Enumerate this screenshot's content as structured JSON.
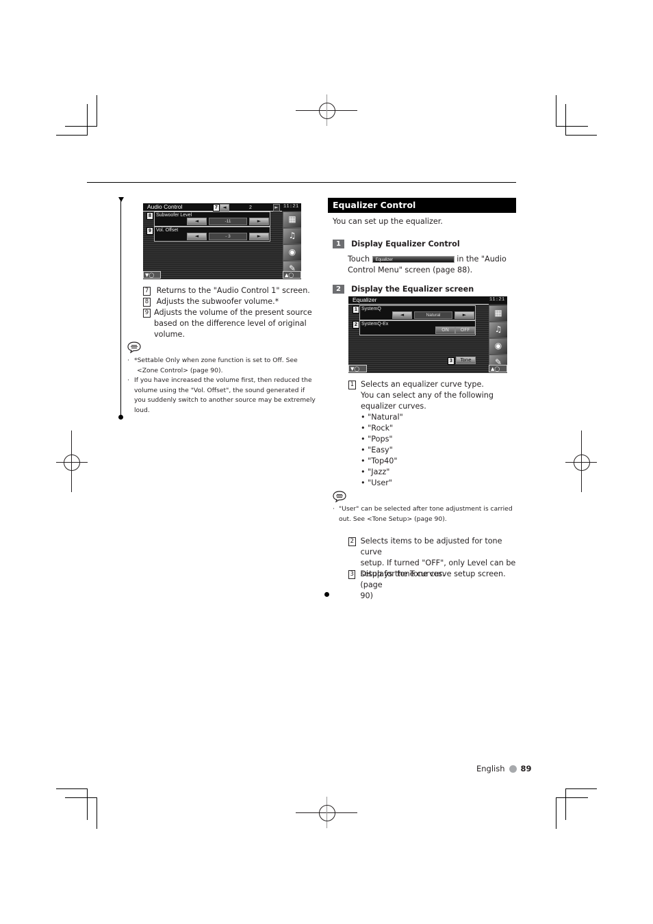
{
  "left_column": {
    "audio_control_screen": {
      "title": "Audio Control",
      "page_badge": "7",
      "page_number": "2",
      "clock": "11:21",
      "rows": [
        {
          "badge": "8",
          "label": "Subwoofer Level",
          "value": "-11"
        },
        {
          "badge": "9",
          "label": "Vol. Offset",
          "value": "- 3"
        }
      ]
    },
    "items": [
      {
        "num": "7",
        "text": "Returns to the \"Audio Control 1\" screen."
      },
      {
        "num": "8",
        "text": "Adjusts the subwoofer volume.*"
      },
      {
        "num": "9",
        "text_lines": [
          "Adjusts the volume of the present source",
          "based on the difference level of original",
          "volume."
        ]
      }
    ],
    "notes": [
      {
        "lines": [
          "*Settable Only when zone function is set to Off. See",
          "<Zone Control> (page 90)."
        ]
      },
      {
        "lines": [
          "If you have increased the volume first, then reduced the",
          "volume using the \"Vol. Offset\", the sound generated if",
          "you suddenly switch to another source may be extremely",
          "loud."
        ]
      }
    ]
  },
  "right_column": {
    "section_title": "Equalizer Control",
    "intro": "You can set up the equalizer.",
    "step1": {
      "num": "1",
      "title": "Display Equalizer Control",
      "touch_prefix": "Touch",
      "button_label": "Equalizer",
      "touch_suffix": "in the \"Audio",
      "line2": "Control Menu\" screen (page 88)."
    },
    "step2": {
      "num": "2",
      "title": "Display the Equalizer screen"
    },
    "equalizer_screen": {
      "title": "Equalizer",
      "clock": "11:21",
      "row1": {
        "badge": "1",
        "label": "SystemQ",
        "value": "Natural"
      },
      "row2": {
        "badge": "2",
        "label": "SystemQ-Ex",
        "on_label": "ON",
        "off_label": "OFF"
      },
      "tone": {
        "badge": "3",
        "label": "Tone"
      }
    },
    "item1": {
      "num": "1",
      "lines": [
        "Selects an equalizer curve type.",
        "You can select any of the following",
        "equalizer curves."
      ],
      "curves": [
        "\"Natural\"",
        "\"Rock\"",
        "\"Pops\"",
        "\"Easy\"",
        "\"Top40\"",
        "\"Jazz\"",
        "\"User\""
      ]
    },
    "note": {
      "lines": [
        "\"User\" can be selected after tone adjustment is carried",
        "out. See <Tone Setup> (page 90)."
      ]
    },
    "item2": {
      "num": "2",
      "lines": [
        "Selects items to be adjusted for tone curve",
        "setup. If turned \"OFF\", only Level can be",
        "setup for tone curves."
      ]
    },
    "item3": {
      "num": "3",
      "lines": [
        "Displays the Tone curve setup screen. (page",
        "90)"
      ]
    }
  },
  "footer": {
    "language": "English",
    "page": "89"
  }
}
